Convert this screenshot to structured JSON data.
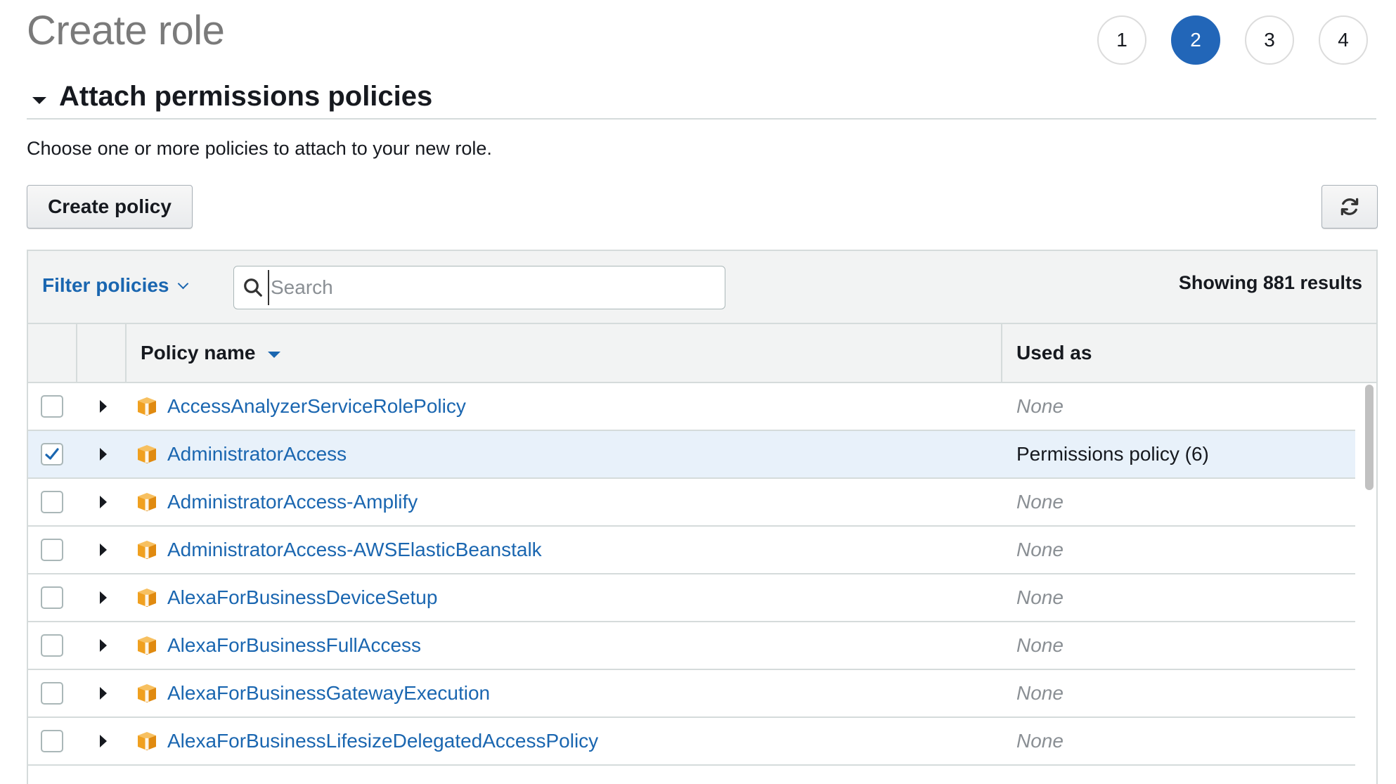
{
  "page": {
    "title": "Create role"
  },
  "steps": [
    {
      "label": "1",
      "active": false
    },
    {
      "label": "2",
      "active": true
    },
    {
      "label": "3",
      "active": false
    },
    {
      "label": "4",
      "active": false
    }
  ],
  "section": {
    "title": "Attach permissions policies",
    "description": "Choose one or more policies to attach to your new role."
  },
  "toolbar": {
    "create_policy_label": "Create policy",
    "refresh_icon": "refresh-icon"
  },
  "filter": {
    "label": "Filter policies",
    "search_placeholder": "Search",
    "search_value": "",
    "results_text": "Showing 881 results"
  },
  "table": {
    "columns": {
      "policy_name": "Policy name",
      "used_as": "Used as"
    },
    "rows": [
      {
        "name": "AccessAnalyzerServiceRolePolicy",
        "used_as": "None",
        "checked": false
      },
      {
        "name": "AdministratorAccess",
        "used_as": "Permissions policy (6)",
        "checked": true
      },
      {
        "name": "AdministratorAccess-Amplify",
        "used_as": "None",
        "checked": false
      },
      {
        "name": "AdministratorAccess-AWSElasticBeanstalk",
        "used_as": "None",
        "checked": false
      },
      {
        "name": "AlexaForBusinessDeviceSetup",
        "used_as": "None",
        "checked": false
      },
      {
        "name": "AlexaForBusinessFullAccess",
        "used_as": "None",
        "checked": false
      },
      {
        "name": "AlexaForBusinessGatewayExecution",
        "used_as": "None",
        "checked": false
      },
      {
        "name": "AlexaForBusinessLifesizeDelegatedAccessPolicy",
        "used_as": "None",
        "checked": false
      }
    ]
  },
  "colors": {
    "accent": "#2266b8",
    "link": "#1a66b0",
    "policy_icon": "#f0a020",
    "selected_row": "#e8f1fa",
    "muted_text": "#8a8f94"
  }
}
